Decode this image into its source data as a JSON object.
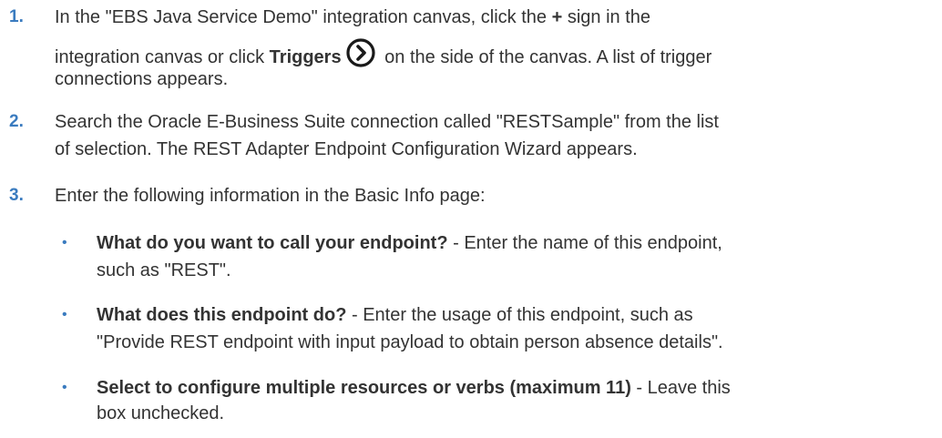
{
  "steps": [
    {
      "number": "1.",
      "line1": {
        "pre": "In the \"EBS Java Service Demo\" integration canvas, click the ",
        "plus": "+",
        "post": " sign in the"
      },
      "line2": {
        "pre": "integration canvas or click ",
        "triggers": "Triggers",
        "post": " on the side of the canvas. A list of trigger"
      },
      "line3": "connections appears.",
      "icon": "chevron-right-circle-icon"
    },
    {
      "number": "2.",
      "line1": "Search the Oracle E-Business Suite connection called \"RESTSample\" from the list",
      "line2": "of selection. The REST Adapter Endpoint Configuration Wizard appears."
    },
    {
      "number": "3.",
      "line1": "Enter the following information in the Basic Info page:",
      "bullet_glyph": "•",
      "bullets": [
        {
          "bold": "What do you want to call your endpoint?",
          "text1": " - Enter the name of this endpoint,",
          "text2": "such as \"REST\"."
        },
        {
          "bold": "What does this endpoint do?",
          "text1": " - Enter the usage of this endpoint, such as",
          "text2": "\"Provide REST endpoint with input payload to obtain person absence details\"."
        },
        {
          "bold": "Select to configure multiple resources or verbs (maximum 11)",
          "text1": " - Leave this",
          "text2": "box unchecked."
        }
      ]
    }
  ],
  "colors": {
    "step_number": "#3a7bbf",
    "text": "#333333"
  }
}
